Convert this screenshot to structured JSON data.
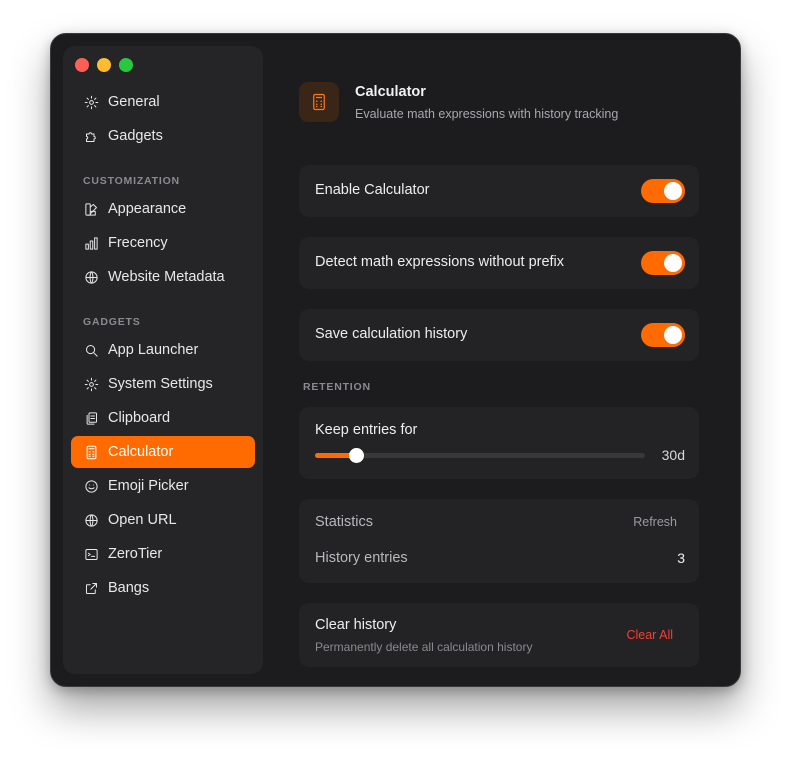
{
  "sidebar": {
    "top_items": [
      {
        "label": "General",
        "icon": "gear-icon"
      },
      {
        "label": "Gadgets",
        "icon": "puzzle-icon"
      }
    ],
    "section_customization": "CUSTOMIZATION",
    "customization_items": [
      {
        "label": "Appearance",
        "icon": "palette-icon"
      },
      {
        "label": "Frecency",
        "icon": "bar-chart-icon"
      },
      {
        "label": "Website Metadata",
        "icon": "globe-icon"
      }
    ],
    "section_gadgets": "GADGETS",
    "gadget_items": [
      {
        "label": "App Launcher",
        "icon": "search-icon"
      },
      {
        "label": "System Settings",
        "icon": "gear-icon"
      },
      {
        "label": "Clipboard",
        "icon": "clipboard-icon"
      },
      {
        "label": "Calculator",
        "icon": "calculator-icon",
        "active": true
      },
      {
        "label": "Emoji Picker",
        "icon": "smiley-icon"
      },
      {
        "label": "Open URL",
        "icon": "globe-icon"
      },
      {
        "label": "ZeroTier",
        "icon": "terminal-icon"
      },
      {
        "label": "Bangs",
        "icon": "external-link-icon"
      }
    ]
  },
  "header": {
    "title": "Calculator",
    "subtitle": "Evaluate math expressions with history tracking"
  },
  "settings": {
    "enable_label": "Enable Calculator",
    "enable_on": true,
    "detect_label": "Detect math expressions without prefix",
    "detect_on": true,
    "save_label": "Save calculation history",
    "save_on": true
  },
  "retention": {
    "section": "RETENTION",
    "label": "Keep entries for",
    "value": "30d",
    "slider_fraction": 0.1
  },
  "statistics": {
    "title": "Statistics",
    "refresh": "Refresh",
    "history_label": "History entries",
    "history_value": "3"
  },
  "clear": {
    "title": "Clear history",
    "subtitle": "Permanently delete all calculation history",
    "button": "Clear All"
  },
  "colors": {
    "accent": "#ff6b00",
    "danger": "#ff3b30",
    "background": "#1c1c1e"
  }
}
